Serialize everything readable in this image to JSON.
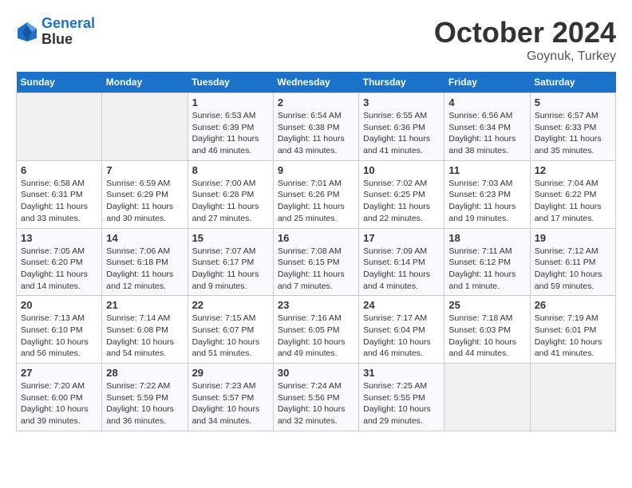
{
  "header": {
    "logo_line1": "General",
    "logo_line2": "Blue",
    "month_title": "October 2024",
    "location": "Goynuk, Turkey"
  },
  "weekdays": [
    "Sunday",
    "Monday",
    "Tuesday",
    "Wednesday",
    "Thursday",
    "Friday",
    "Saturday"
  ],
  "weeks": [
    [
      {
        "day": "",
        "info": ""
      },
      {
        "day": "",
        "info": ""
      },
      {
        "day": "1",
        "info": "Sunrise: 6:53 AM\nSunset: 6:39 PM\nDaylight: 11 hours and 46 minutes."
      },
      {
        "day": "2",
        "info": "Sunrise: 6:54 AM\nSunset: 6:38 PM\nDaylight: 11 hours and 43 minutes."
      },
      {
        "day": "3",
        "info": "Sunrise: 6:55 AM\nSunset: 6:36 PM\nDaylight: 11 hours and 41 minutes."
      },
      {
        "day": "4",
        "info": "Sunrise: 6:56 AM\nSunset: 6:34 PM\nDaylight: 11 hours and 38 minutes."
      },
      {
        "day": "5",
        "info": "Sunrise: 6:57 AM\nSunset: 6:33 PM\nDaylight: 11 hours and 35 minutes."
      }
    ],
    [
      {
        "day": "6",
        "info": "Sunrise: 6:58 AM\nSunset: 6:31 PM\nDaylight: 11 hours and 33 minutes."
      },
      {
        "day": "7",
        "info": "Sunrise: 6:59 AM\nSunset: 6:29 PM\nDaylight: 11 hours and 30 minutes."
      },
      {
        "day": "8",
        "info": "Sunrise: 7:00 AM\nSunset: 6:28 PM\nDaylight: 11 hours and 27 minutes."
      },
      {
        "day": "9",
        "info": "Sunrise: 7:01 AM\nSunset: 6:26 PM\nDaylight: 11 hours and 25 minutes."
      },
      {
        "day": "10",
        "info": "Sunrise: 7:02 AM\nSunset: 6:25 PM\nDaylight: 11 hours and 22 minutes."
      },
      {
        "day": "11",
        "info": "Sunrise: 7:03 AM\nSunset: 6:23 PM\nDaylight: 11 hours and 19 minutes."
      },
      {
        "day": "12",
        "info": "Sunrise: 7:04 AM\nSunset: 6:22 PM\nDaylight: 11 hours and 17 minutes."
      }
    ],
    [
      {
        "day": "13",
        "info": "Sunrise: 7:05 AM\nSunset: 6:20 PM\nDaylight: 11 hours and 14 minutes."
      },
      {
        "day": "14",
        "info": "Sunrise: 7:06 AM\nSunset: 6:18 PM\nDaylight: 11 hours and 12 minutes."
      },
      {
        "day": "15",
        "info": "Sunrise: 7:07 AM\nSunset: 6:17 PM\nDaylight: 11 hours and 9 minutes."
      },
      {
        "day": "16",
        "info": "Sunrise: 7:08 AM\nSunset: 6:15 PM\nDaylight: 11 hours and 7 minutes."
      },
      {
        "day": "17",
        "info": "Sunrise: 7:09 AM\nSunset: 6:14 PM\nDaylight: 11 hours and 4 minutes."
      },
      {
        "day": "18",
        "info": "Sunrise: 7:11 AM\nSunset: 6:12 PM\nDaylight: 11 hours and 1 minute."
      },
      {
        "day": "19",
        "info": "Sunrise: 7:12 AM\nSunset: 6:11 PM\nDaylight: 10 hours and 59 minutes."
      }
    ],
    [
      {
        "day": "20",
        "info": "Sunrise: 7:13 AM\nSunset: 6:10 PM\nDaylight: 10 hours and 56 minutes."
      },
      {
        "day": "21",
        "info": "Sunrise: 7:14 AM\nSunset: 6:08 PM\nDaylight: 10 hours and 54 minutes."
      },
      {
        "day": "22",
        "info": "Sunrise: 7:15 AM\nSunset: 6:07 PM\nDaylight: 10 hours and 51 minutes."
      },
      {
        "day": "23",
        "info": "Sunrise: 7:16 AM\nSunset: 6:05 PM\nDaylight: 10 hours and 49 minutes."
      },
      {
        "day": "24",
        "info": "Sunrise: 7:17 AM\nSunset: 6:04 PM\nDaylight: 10 hours and 46 minutes."
      },
      {
        "day": "25",
        "info": "Sunrise: 7:18 AM\nSunset: 6:03 PM\nDaylight: 10 hours and 44 minutes."
      },
      {
        "day": "26",
        "info": "Sunrise: 7:19 AM\nSunset: 6:01 PM\nDaylight: 10 hours and 41 minutes."
      }
    ],
    [
      {
        "day": "27",
        "info": "Sunrise: 7:20 AM\nSunset: 6:00 PM\nDaylight: 10 hours and 39 minutes."
      },
      {
        "day": "28",
        "info": "Sunrise: 7:22 AM\nSunset: 5:59 PM\nDaylight: 10 hours and 36 minutes."
      },
      {
        "day": "29",
        "info": "Sunrise: 7:23 AM\nSunset: 5:57 PM\nDaylight: 10 hours and 34 minutes."
      },
      {
        "day": "30",
        "info": "Sunrise: 7:24 AM\nSunset: 5:56 PM\nDaylight: 10 hours and 32 minutes."
      },
      {
        "day": "31",
        "info": "Sunrise: 7:25 AM\nSunset: 5:55 PM\nDaylight: 10 hours and 29 minutes."
      },
      {
        "day": "",
        "info": ""
      },
      {
        "day": "",
        "info": ""
      }
    ]
  ]
}
